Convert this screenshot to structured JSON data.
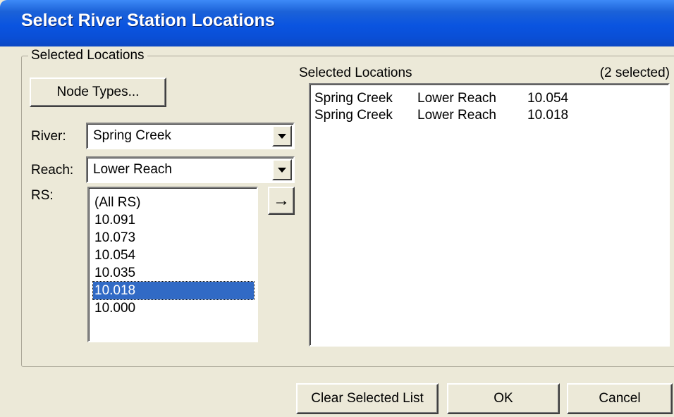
{
  "window": {
    "title": "Select River Station Locations"
  },
  "group": {
    "legend": "Selected Locations"
  },
  "node_types_button": "Node Types...",
  "river": {
    "label": "River:",
    "value": "Spring Creek"
  },
  "reach": {
    "label": "Reach:",
    "value": "Lower Reach"
  },
  "rs": {
    "label": "RS:",
    "items": [
      "(All RS)",
      "10.091",
      "10.073",
      "10.054",
      "10.035",
      "10.018",
      "10.000"
    ],
    "selected_index": 5
  },
  "add_button": {
    "icon": "arrow-right-icon",
    "glyph": "→"
  },
  "selected_locations": {
    "header": "Selected Locations",
    "count_label": "(2 selected)",
    "rows": [
      {
        "river": "Spring Creek",
        "reach": "Lower Reach",
        "rs": "10.054"
      },
      {
        "river": "Spring Creek",
        "reach": "Lower Reach",
        "rs": "10.018"
      }
    ]
  },
  "buttons": {
    "clear": "Clear Selected List",
    "ok": "OK",
    "cancel": "Cancel"
  },
  "colors": {
    "titlebar": "#0a54e0",
    "selection": "#316ac5",
    "background": "#ece9d8"
  }
}
